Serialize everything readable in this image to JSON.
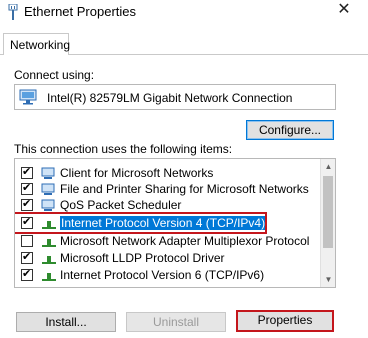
{
  "window": {
    "title": "Ethernet Properties",
    "close_glyph": "✕"
  },
  "tabs": [
    {
      "label": "Networking",
      "active": true
    }
  ],
  "connect_using": {
    "label": "Connect using:",
    "adapter": "Intel(R) 82579LM Gigabit Network Connection",
    "icon": "network-adapter-icon"
  },
  "buttons": {
    "configure": "Configure...",
    "install": "Install...",
    "uninstall": "Uninstall",
    "properties": "Properties"
  },
  "items_label": "This connection uses the following items:",
  "items": [
    {
      "label": "Client for Microsoft Networks",
      "checked": true,
      "icon": "client-icon"
    },
    {
      "label": "File and Printer Sharing for Microsoft Networks",
      "checked": true,
      "icon": "file-share-icon"
    },
    {
      "label": "QoS Packet Scheduler",
      "checked": true,
      "icon": "qos-icon"
    },
    {
      "label": "Internet Protocol Version 4 (TCP/IPv4)",
      "checked": true,
      "icon": "protocol-icon",
      "selected": true
    },
    {
      "label": "Microsoft Network Adapter Multiplexor Protocol",
      "checked": false,
      "icon": "protocol-icon"
    },
    {
      "label": "Microsoft LLDP Protocol Driver",
      "checked": true,
      "icon": "protocol-icon"
    },
    {
      "label": "Internet Protocol Version 6 (TCP/IPv6)",
      "checked": true,
      "icon": "protocol-icon"
    }
  ],
  "colors": {
    "highlight_border": "#c4161c",
    "selection": "#0078d7",
    "button_focus": "#0078d7"
  }
}
